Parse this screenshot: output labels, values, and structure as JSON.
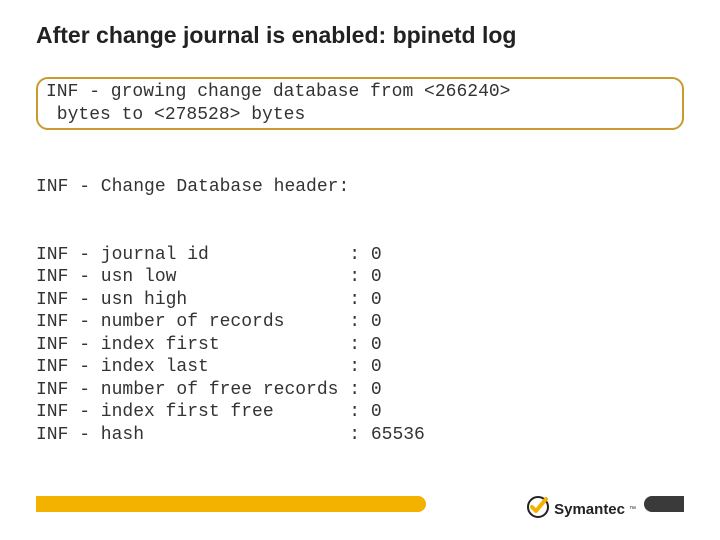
{
  "slide": {
    "title": "After change journal is enabled: bpinetd log",
    "highlight_line1": "INF - growing change database from <266240>",
    "highlight_line2": " bytes to <278528> bytes",
    "header_line": "INF - Change Database header:",
    "rows": [
      {
        "label": "journal id",
        "value": "0"
      },
      {
        "label": "usn low",
        "value": "0"
      },
      {
        "label": "usn high",
        "value": "0"
      },
      {
        "label": "number of records",
        "value": "0"
      },
      {
        "label": "index first",
        "value": "0"
      },
      {
        "label": "index last",
        "value": "0"
      },
      {
        "label": "number of free records",
        "value": "0"
      },
      {
        "label": "index first free",
        "value": "0"
      },
      {
        "label": "hash",
        "value": "65536"
      }
    ]
  },
  "brand": {
    "name": "Symantec",
    "tm": "™"
  }
}
